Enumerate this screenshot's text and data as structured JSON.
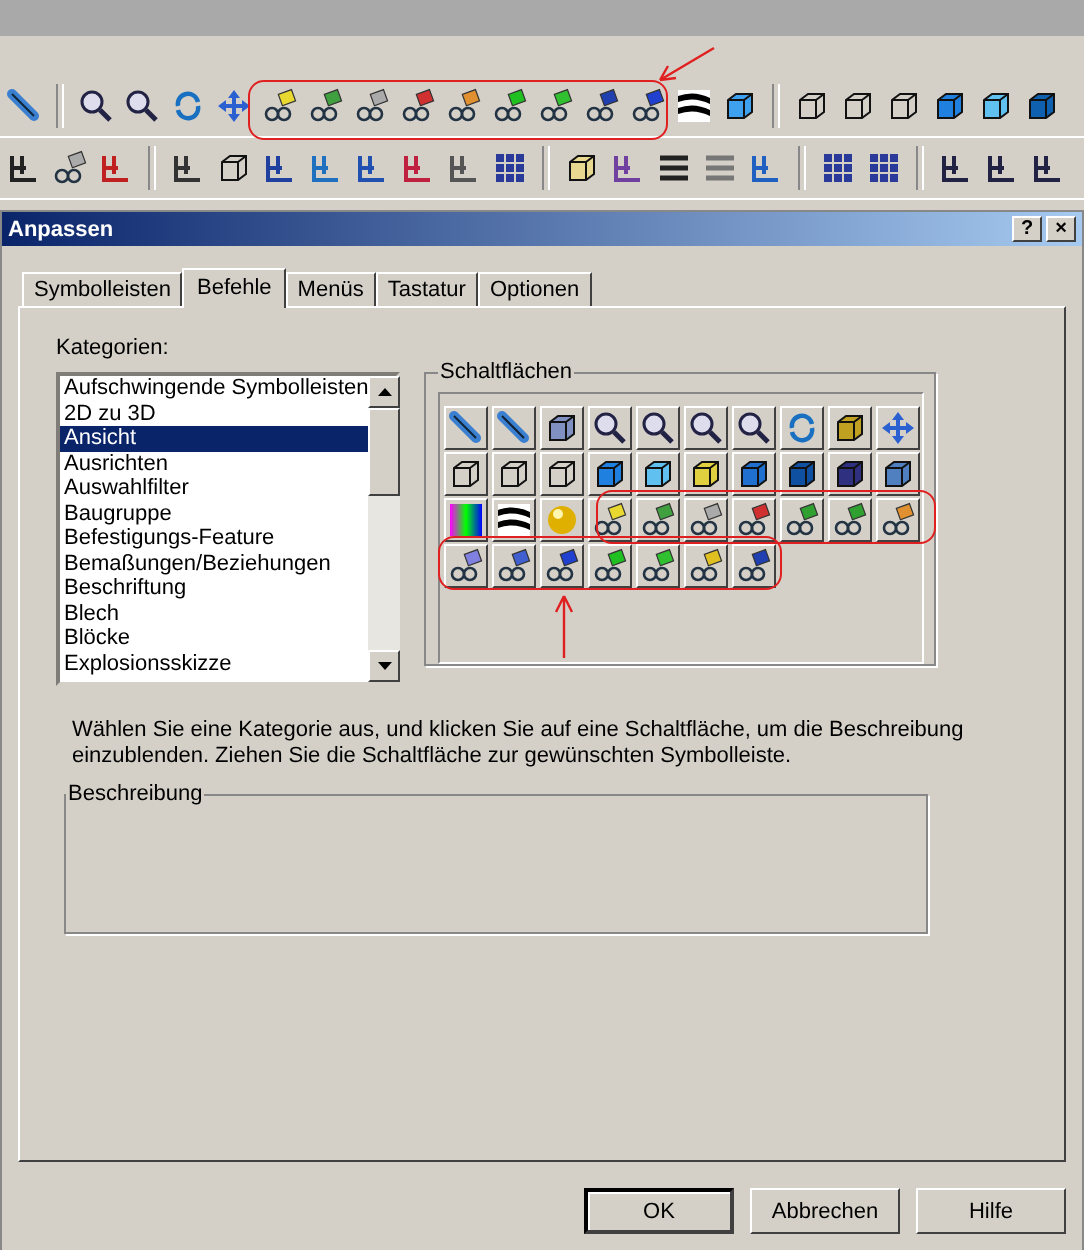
{
  "window": {
    "title": "Anpassen",
    "title_buttons": [
      "?",
      "×"
    ]
  },
  "tabs": [
    {
      "label": "Symbolleisten",
      "selected": false
    },
    {
      "label": "Befehle",
      "selected": true
    },
    {
      "label": "Menüs",
      "selected": false
    },
    {
      "label": "Tastatur",
      "selected": false
    },
    {
      "label": "Optionen",
      "selected": false
    }
  ],
  "categories": {
    "label": "Kategorien:",
    "items": [
      {
        "label": "Aufschwingende Symbolleisten",
        "selected": false
      },
      {
        "label": "2D zu 3D",
        "selected": false
      },
      {
        "label": "Ansicht",
        "selected": true
      },
      {
        "label": "Ausrichten",
        "selected": false
      },
      {
        "label": "Auswahlfilter",
        "selected": false
      },
      {
        "label": "Baugruppe",
        "selected": false
      },
      {
        "label": "Befestigungs-Feature",
        "selected": false
      },
      {
        "label": "Bemaßungen/Beziehungen",
        "selected": false
      },
      {
        "label": "Beschriftung",
        "selected": false
      },
      {
        "label": "Blech",
        "selected": false
      },
      {
        "label": "Blöcke",
        "selected": false
      },
      {
        "label": "Explosionsskizze",
        "selected": false
      }
    ]
  },
  "buttons_group": {
    "label": "Schaltflächen"
  },
  "instructions": "Wählen Sie eine Kategorie aus, und klicken Sie auf eine Schaltfläche, um die Beschreibung einzublenden. Ziehen Sie die Schaltfläche zur gewünschten Symbolleiste.",
  "description_group": {
    "label": "Beschreibung"
  },
  "dialog_buttons": [
    {
      "label": "OK",
      "default": true
    },
    {
      "label": "Abbrechen",
      "default": false
    },
    {
      "label": "Hilfe",
      "default": false
    }
  ]
}
